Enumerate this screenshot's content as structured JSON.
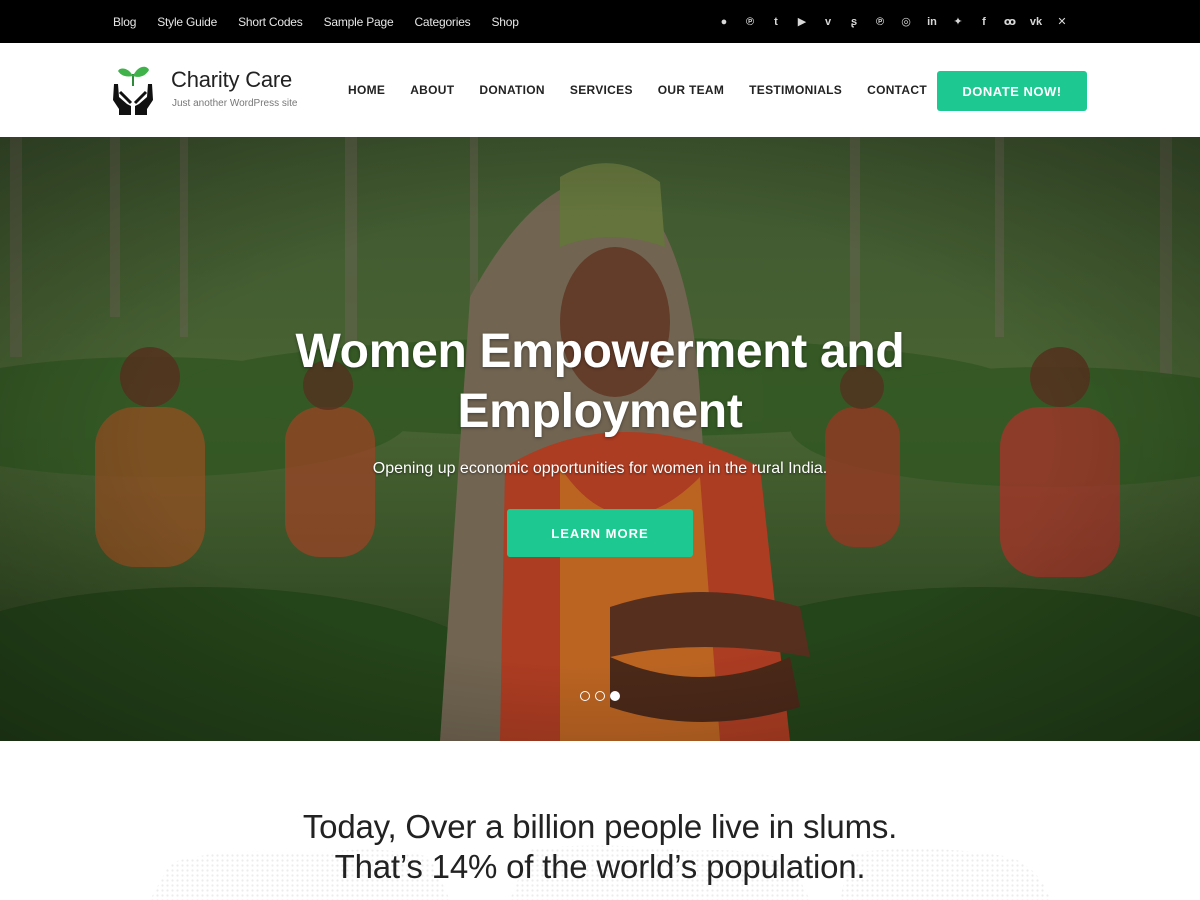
{
  "topbar": {
    "links": [
      "Blog",
      "Style Guide",
      "Short Codes",
      "Sample Page",
      "Categories",
      "Shop"
    ],
    "social": [
      {
        "icon": "flickr-icon",
        "glyph": "●●"
      },
      {
        "icon": "pinterest-icon",
        "glyph": "℗"
      },
      {
        "icon": "tumblr-icon",
        "glyph": "t"
      },
      {
        "icon": "youtube-icon",
        "glyph": "▶"
      },
      {
        "icon": "vimeo-icon",
        "glyph": "v"
      },
      {
        "icon": "stumbleupon-icon",
        "glyph": "ʂ"
      },
      {
        "icon": "pinterest-alt-icon",
        "glyph": "℗"
      },
      {
        "icon": "instagram-icon",
        "glyph": "◎"
      },
      {
        "icon": "linkedin-icon",
        "glyph": "in"
      },
      {
        "icon": "twitter-icon",
        "glyph": "✓"
      },
      {
        "icon": "facebook-icon",
        "glyph": "f"
      },
      {
        "icon": "odnoklassniki-icon",
        "glyph": "ꝏ"
      },
      {
        "icon": "vk-icon",
        "glyph": "vk"
      },
      {
        "icon": "xing-icon",
        "glyph": "✕"
      }
    ]
  },
  "header": {
    "site_title": "Charity Care",
    "tagline": "Just another WordPress site",
    "nav": [
      "HOME",
      "ABOUT",
      "DONATION",
      "SERVICES",
      "OUR TEAM",
      "TESTIMONIALS",
      "CONTACT"
    ],
    "donate_label": "DONATE NOW!"
  },
  "hero": {
    "title": "Women Empowerment and Employment",
    "subtitle": "Opening up economic opportunities for women in the rural India.",
    "button_label": "LEARN MORE",
    "slides": 3,
    "active_slide": 3
  },
  "stats": {
    "line1": "Today, Over a billion people live in slums.",
    "line2": "That’s 14% of the world’s population."
  },
  "colors": {
    "accent": "#1dc990",
    "topbar": "#000000",
    "text": "#222222"
  }
}
